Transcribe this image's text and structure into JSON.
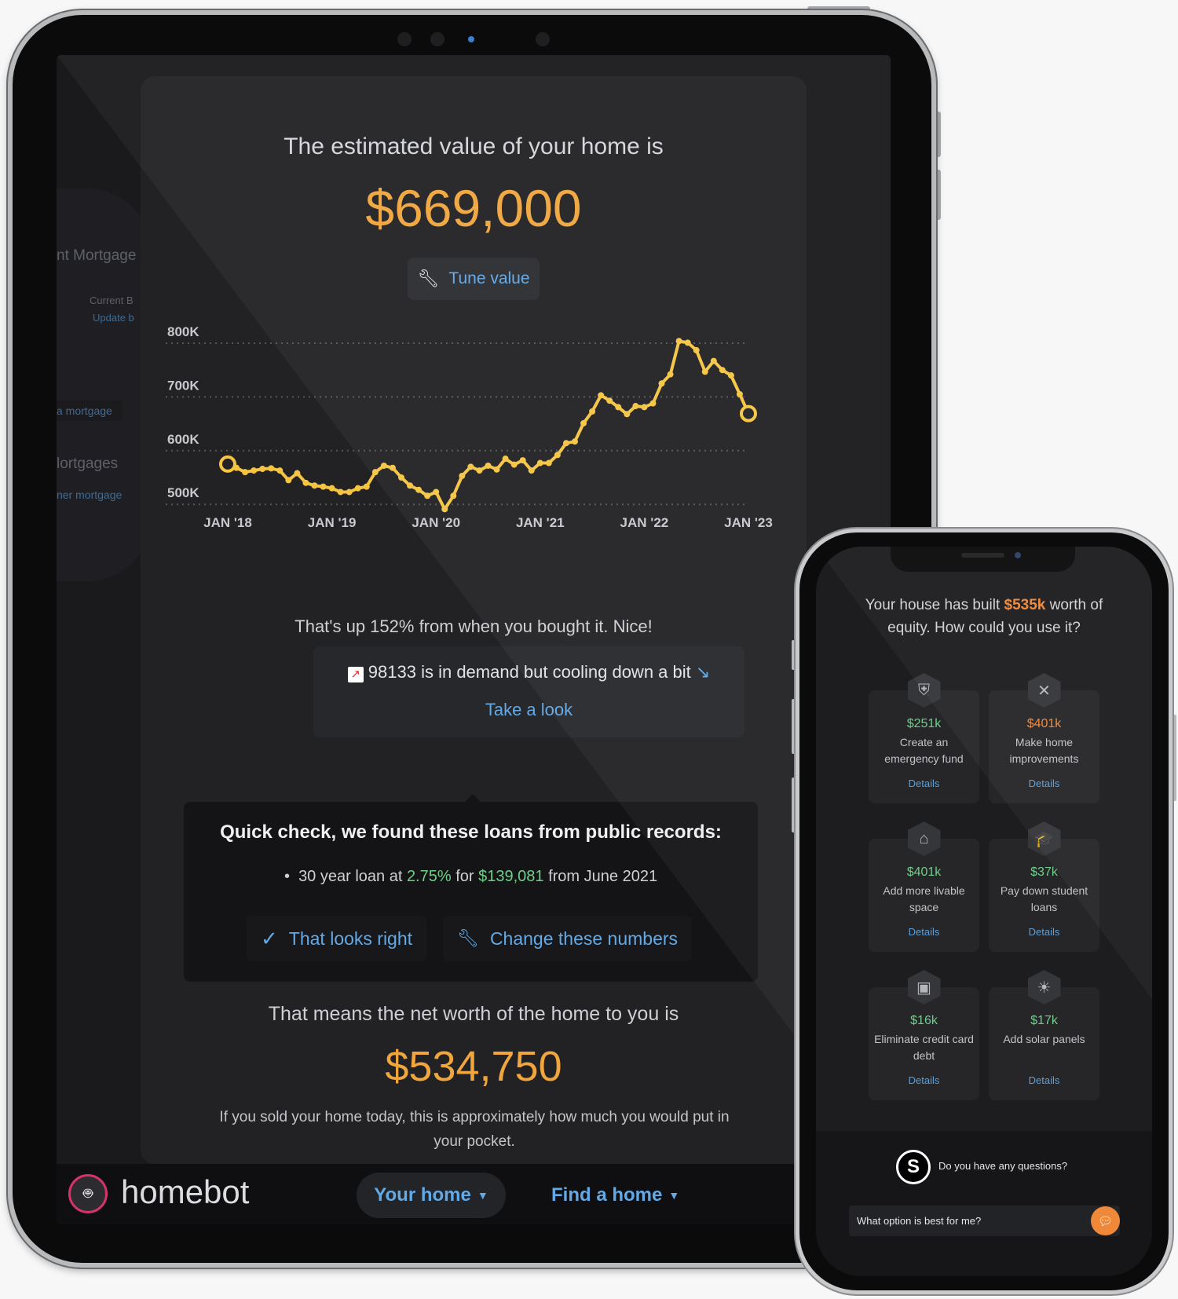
{
  "tablet": {
    "sidebar_ghost": [
      "nt Mortgage",
      "Current B",
      "Update b",
      "a mortgage",
      "lortgages",
      "ner mortgage"
    ],
    "title": "The estimated value of your home is",
    "value": "$669,000",
    "tune_label": "Tune value",
    "up_text": "That's up 152% from when you bought it. Nice!",
    "demand_text": "98133 is in demand but cooling down a bit",
    "take_look": "Take a look",
    "loans": {
      "heading": "Quick check, we found these loans from public records:",
      "line_prefix": "30 year loan at ",
      "rate": "2.75%",
      "line_mid": " for ",
      "amount": "$139,081",
      "line_suffix": " from June 2021",
      "confirm": "That looks right",
      "change": "Change these numbers"
    },
    "networth_label": "That means the net worth of the home to you is",
    "networth_value": "$534,750",
    "sold_text": "If you sold your home today, this is approximately how much you would put in your pocket.",
    "nav": {
      "brand": "homebot",
      "your_home": "Your home",
      "find_home": "Find a home"
    }
  },
  "chart_data": {
    "type": "line",
    "x_ticks": [
      "JAN '18",
      "JAN '19",
      "JAN '20",
      "JAN '21",
      "JAN '22",
      "JAN '23"
    ],
    "y_ticks": [
      "800K",
      "700K",
      "600K",
      "500K"
    ],
    "y_tick_values": [
      800,
      700,
      600,
      500
    ],
    "ylim": [
      480,
      810
    ],
    "grid": true,
    "line_color": "#f5c542",
    "series": [
      {
        "values": [
          [
            "2018-01",
            575
          ],
          [
            "2018-02",
            568
          ],
          [
            "2018-03",
            560
          ],
          [
            "2018-04",
            563
          ],
          [
            "2018-05",
            566
          ],
          [
            "2018-06",
            567
          ],
          [
            "2018-07",
            563
          ],
          [
            "2018-08",
            545
          ],
          [
            "2018-09",
            558
          ],
          [
            "2018-10",
            540
          ],
          [
            "2018-11",
            535
          ],
          [
            "2018-12",
            533
          ],
          [
            "2019-01",
            530
          ],
          [
            "2019-02",
            523
          ],
          [
            "2019-03",
            523
          ],
          [
            "2019-04",
            530
          ],
          [
            "2019-05",
            533
          ],
          [
            "2019-06",
            560
          ],
          [
            "2019-07",
            572
          ],
          [
            "2019-08",
            568
          ],
          [
            "2019-09",
            550
          ],
          [
            "2019-10",
            535
          ],
          [
            "2019-11",
            527
          ],
          [
            "2019-12",
            516
          ],
          [
            "2020-01",
            523
          ],
          [
            "2020-02",
            491
          ],
          [
            "2020-03",
            516
          ],
          [
            "2020-04",
            553
          ],
          [
            "2020-05",
            570
          ],
          [
            "2020-06",
            563
          ],
          [
            "2020-07",
            572
          ],
          [
            "2020-08",
            565
          ],
          [
            "2020-09",
            585
          ],
          [
            "2020-10",
            574
          ],
          [
            "2020-11",
            582
          ],
          [
            "2020-12",
            563
          ],
          [
            "2021-01",
            577
          ],
          [
            "2021-02",
            577
          ],
          [
            "2021-03",
            592
          ],
          [
            "2021-04",
            614
          ],
          [
            "2021-05",
            617
          ],
          [
            "2021-06",
            651
          ],
          [
            "2021-07",
            673
          ],
          [
            "2021-08",
            703
          ],
          [
            "2021-09",
            693
          ],
          [
            "2021-10",
            681
          ],
          [
            "2021-11",
            668
          ],
          [
            "2021-12",
            683
          ],
          [
            "2022-01",
            681
          ],
          [
            "2022-02",
            688
          ],
          [
            "2022-03",
            725
          ],
          [
            "2022-04",
            742
          ],
          [
            "2022-05",
            804
          ],
          [
            "2022-06",
            801
          ],
          [
            "2022-07",
            787
          ],
          [
            "2022-08",
            747
          ],
          [
            "2022-09",
            767
          ],
          [
            "2022-10",
            750
          ],
          [
            "2022-11",
            740
          ],
          [
            "2022-12",
            705
          ],
          [
            "2023-01",
            669
          ]
        ]
      }
    ]
  },
  "phone": {
    "heading_pre": "Your house has built ",
    "heading_amount": "$535k",
    "heading_post": " worth of equity. How could you use it?",
    "options": [
      {
        "amount": "$251k",
        "label": "Create an emergency fund",
        "details": "Details",
        "icon": "shield-icon",
        "color": "#6fcf8a",
        "glyph": "⛨"
      },
      {
        "amount": "$401k",
        "label": "Make home improvements",
        "details": "Details",
        "icon": "tools-icon",
        "color": "#f0883a",
        "glyph": "✕"
      },
      {
        "amount": "$401k",
        "label": "Add more livable space",
        "details": "Details",
        "icon": "houses-icon",
        "color": "#6fcf8a",
        "glyph": "⌂"
      },
      {
        "amount": "$37k",
        "label": "Pay down student loans",
        "details": "Details",
        "icon": "graduation-cap-icon",
        "color": "#6fcf8a",
        "glyph": "🎓"
      },
      {
        "amount": "$16k",
        "label": "Eliminate credit card debt",
        "details": "Details",
        "icon": "wallet-icon",
        "color": "#6fcf8a",
        "glyph": "▣"
      },
      {
        "amount": "$17k",
        "label": "Add solar panels",
        "details": "Details",
        "icon": "sun-icon",
        "color": "#6fcf8a",
        "glyph": "☀"
      }
    ],
    "chat_prompt": "Do you have any questions?",
    "chat_input": "What option is best for me?"
  },
  "colors": {
    "accent_orange": "#f0a63c",
    "link_blue": "#62a9e6",
    "positive_green": "#6fcf8a",
    "brand_pink": "#d6336c"
  }
}
